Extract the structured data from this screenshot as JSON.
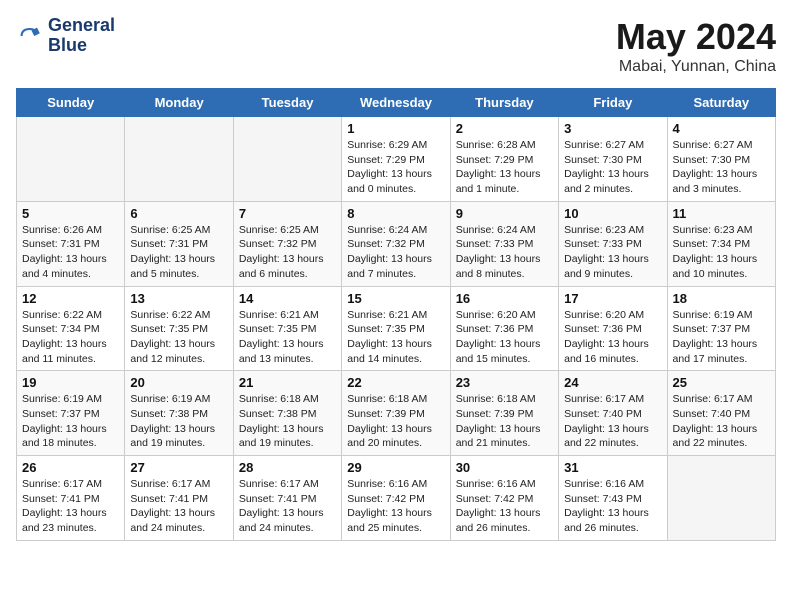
{
  "header": {
    "logo_line1": "General",
    "logo_line2": "Blue",
    "month": "May 2024",
    "location": "Mabai, Yunnan, China"
  },
  "weekdays": [
    "Sunday",
    "Monday",
    "Tuesday",
    "Wednesday",
    "Thursday",
    "Friday",
    "Saturday"
  ],
  "weeks": [
    [
      {
        "day": "",
        "sunrise": "",
        "sunset": "",
        "daylight": "",
        "empty": true
      },
      {
        "day": "",
        "sunrise": "",
        "sunset": "",
        "daylight": "",
        "empty": true
      },
      {
        "day": "",
        "sunrise": "",
        "sunset": "",
        "daylight": "",
        "empty": true
      },
      {
        "day": "1",
        "sunrise": "Sunrise: 6:29 AM",
        "sunset": "Sunset: 7:29 PM",
        "daylight": "Daylight: 13 hours and 0 minutes.",
        "empty": false
      },
      {
        "day": "2",
        "sunrise": "Sunrise: 6:28 AM",
        "sunset": "Sunset: 7:29 PM",
        "daylight": "Daylight: 13 hours and 1 minute.",
        "empty": false
      },
      {
        "day": "3",
        "sunrise": "Sunrise: 6:27 AM",
        "sunset": "Sunset: 7:30 PM",
        "daylight": "Daylight: 13 hours and 2 minutes.",
        "empty": false
      },
      {
        "day": "4",
        "sunrise": "Sunrise: 6:27 AM",
        "sunset": "Sunset: 7:30 PM",
        "daylight": "Daylight: 13 hours and 3 minutes.",
        "empty": false
      }
    ],
    [
      {
        "day": "5",
        "sunrise": "Sunrise: 6:26 AM",
        "sunset": "Sunset: 7:31 PM",
        "daylight": "Daylight: 13 hours and 4 minutes.",
        "empty": false
      },
      {
        "day": "6",
        "sunrise": "Sunrise: 6:25 AM",
        "sunset": "Sunset: 7:31 PM",
        "daylight": "Daylight: 13 hours and 5 minutes.",
        "empty": false
      },
      {
        "day": "7",
        "sunrise": "Sunrise: 6:25 AM",
        "sunset": "Sunset: 7:32 PM",
        "daylight": "Daylight: 13 hours and 6 minutes.",
        "empty": false
      },
      {
        "day": "8",
        "sunrise": "Sunrise: 6:24 AM",
        "sunset": "Sunset: 7:32 PM",
        "daylight": "Daylight: 13 hours and 7 minutes.",
        "empty": false
      },
      {
        "day": "9",
        "sunrise": "Sunrise: 6:24 AM",
        "sunset": "Sunset: 7:33 PM",
        "daylight": "Daylight: 13 hours and 8 minutes.",
        "empty": false
      },
      {
        "day": "10",
        "sunrise": "Sunrise: 6:23 AM",
        "sunset": "Sunset: 7:33 PM",
        "daylight": "Daylight: 13 hours and 9 minutes.",
        "empty": false
      },
      {
        "day": "11",
        "sunrise": "Sunrise: 6:23 AM",
        "sunset": "Sunset: 7:34 PM",
        "daylight": "Daylight: 13 hours and 10 minutes.",
        "empty": false
      }
    ],
    [
      {
        "day": "12",
        "sunrise": "Sunrise: 6:22 AM",
        "sunset": "Sunset: 7:34 PM",
        "daylight": "Daylight: 13 hours and 11 minutes.",
        "empty": false
      },
      {
        "day": "13",
        "sunrise": "Sunrise: 6:22 AM",
        "sunset": "Sunset: 7:35 PM",
        "daylight": "Daylight: 13 hours and 12 minutes.",
        "empty": false
      },
      {
        "day": "14",
        "sunrise": "Sunrise: 6:21 AM",
        "sunset": "Sunset: 7:35 PM",
        "daylight": "Daylight: 13 hours and 13 minutes.",
        "empty": false
      },
      {
        "day": "15",
        "sunrise": "Sunrise: 6:21 AM",
        "sunset": "Sunset: 7:35 PM",
        "daylight": "Daylight: 13 hours and 14 minutes.",
        "empty": false
      },
      {
        "day": "16",
        "sunrise": "Sunrise: 6:20 AM",
        "sunset": "Sunset: 7:36 PM",
        "daylight": "Daylight: 13 hours and 15 minutes.",
        "empty": false
      },
      {
        "day": "17",
        "sunrise": "Sunrise: 6:20 AM",
        "sunset": "Sunset: 7:36 PM",
        "daylight": "Daylight: 13 hours and 16 minutes.",
        "empty": false
      },
      {
        "day": "18",
        "sunrise": "Sunrise: 6:19 AM",
        "sunset": "Sunset: 7:37 PM",
        "daylight": "Daylight: 13 hours and 17 minutes.",
        "empty": false
      }
    ],
    [
      {
        "day": "19",
        "sunrise": "Sunrise: 6:19 AM",
        "sunset": "Sunset: 7:37 PM",
        "daylight": "Daylight: 13 hours and 18 minutes.",
        "empty": false
      },
      {
        "day": "20",
        "sunrise": "Sunrise: 6:19 AM",
        "sunset": "Sunset: 7:38 PM",
        "daylight": "Daylight: 13 hours and 19 minutes.",
        "empty": false
      },
      {
        "day": "21",
        "sunrise": "Sunrise: 6:18 AM",
        "sunset": "Sunset: 7:38 PM",
        "daylight": "Daylight: 13 hours and 19 minutes.",
        "empty": false
      },
      {
        "day": "22",
        "sunrise": "Sunrise: 6:18 AM",
        "sunset": "Sunset: 7:39 PM",
        "daylight": "Daylight: 13 hours and 20 minutes.",
        "empty": false
      },
      {
        "day": "23",
        "sunrise": "Sunrise: 6:18 AM",
        "sunset": "Sunset: 7:39 PM",
        "daylight": "Daylight: 13 hours and 21 minutes.",
        "empty": false
      },
      {
        "day": "24",
        "sunrise": "Sunrise: 6:17 AM",
        "sunset": "Sunset: 7:40 PM",
        "daylight": "Daylight: 13 hours and 22 minutes.",
        "empty": false
      },
      {
        "day": "25",
        "sunrise": "Sunrise: 6:17 AM",
        "sunset": "Sunset: 7:40 PM",
        "daylight": "Daylight: 13 hours and 22 minutes.",
        "empty": false
      }
    ],
    [
      {
        "day": "26",
        "sunrise": "Sunrise: 6:17 AM",
        "sunset": "Sunset: 7:41 PM",
        "daylight": "Daylight: 13 hours and 23 minutes.",
        "empty": false
      },
      {
        "day": "27",
        "sunrise": "Sunrise: 6:17 AM",
        "sunset": "Sunset: 7:41 PM",
        "daylight": "Daylight: 13 hours and 24 minutes.",
        "empty": false
      },
      {
        "day": "28",
        "sunrise": "Sunrise: 6:17 AM",
        "sunset": "Sunset: 7:41 PM",
        "daylight": "Daylight: 13 hours and 24 minutes.",
        "empty": false
      },
      {
        "day": "29",
        "sunrise": "Sunrise: 6:16 AM",
        "sunset": "Sunset: 7:42 PM",
        "daylight": "Daylight: 13 hours and 25 minutes.",
        "empty": false
      },
      {
        "day": "30",
        "sunrise": "Sunrise: 6:16 AM",
        "sunset": "Sunset: 7:42 PM",
        "daylight": "Daylight: 13 hours and 26 minutes.",
        "empty": false
      },
      {
        "day": "31",
        "sunrise": "Sunrise: 6:16 AM",
        "sunset": "Sunset: 7:43 PM",
        "daylight": "Daylight: 13 hours and 26 minutes.",
        "empty": false
      },
      {
        "day": "",
        "sunrise": "",
        "sunset": "",
        "daylight": "",
        "empty": true
      }
    ]
  ]
}
